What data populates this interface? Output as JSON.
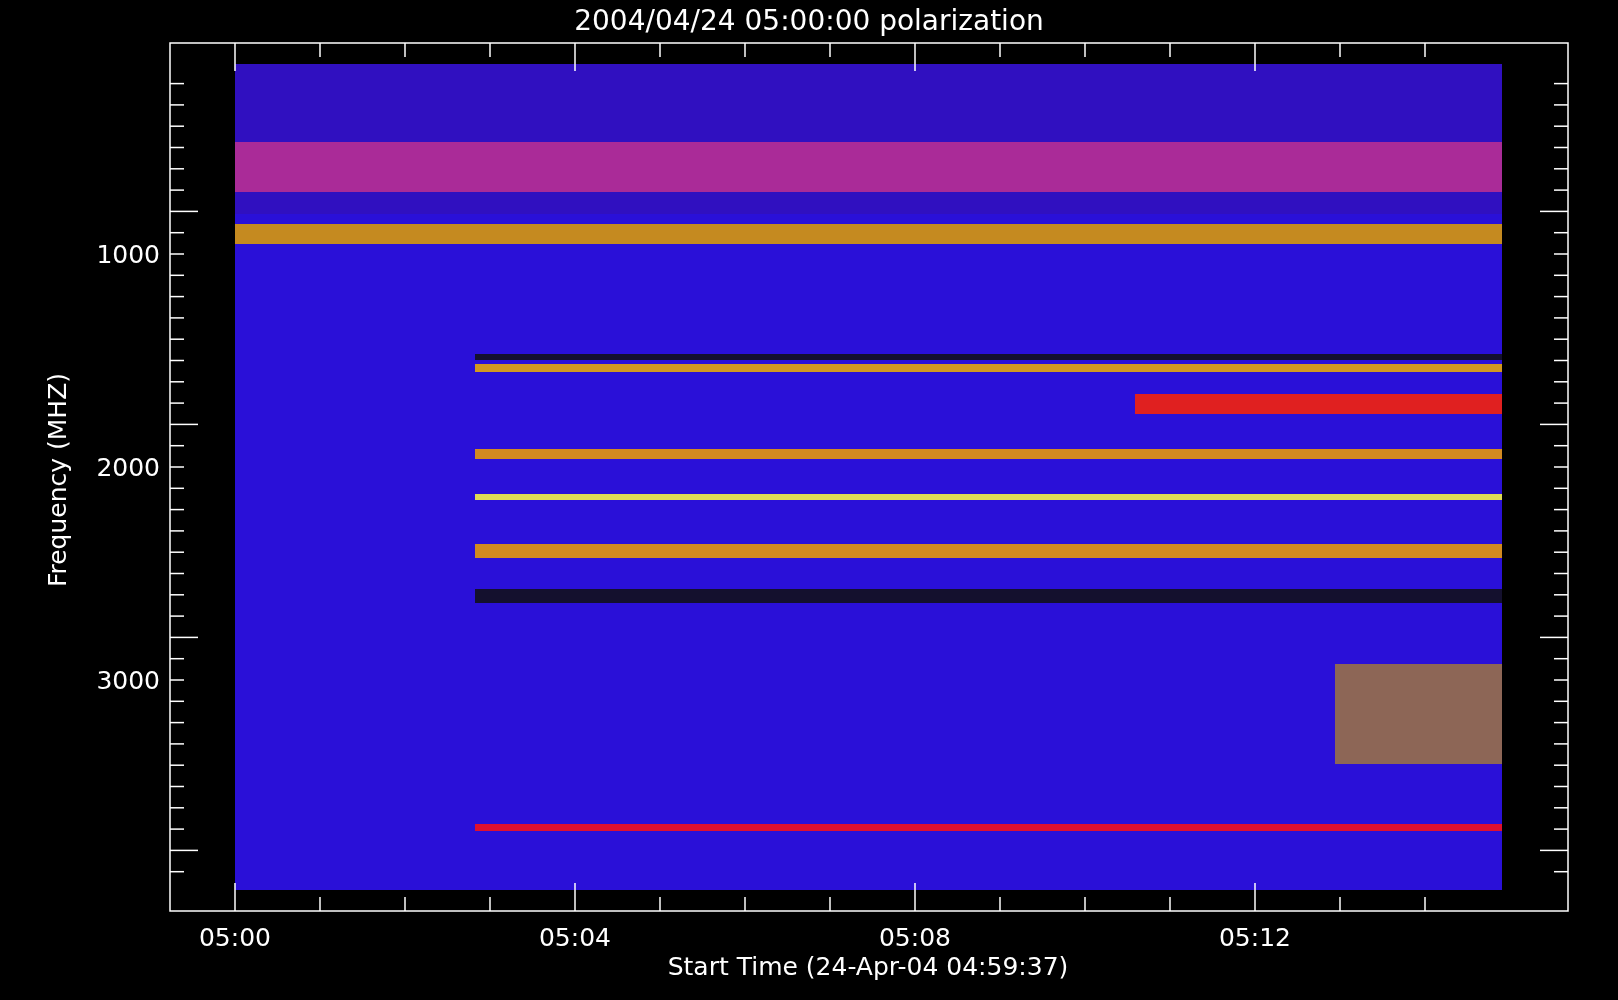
{
  "title": "2004/04/24 05:00:00 polarization",
  "y_axis": {
    "label": "Frequency (MHZ)",
    "tick_labels": [
      "1000",
      "2000",
      "3000"
    ]
  },
  "x_axis": {
    "label": "Start Time (24-Apr-04 04:59:37)",
    "tick_labels": [
      "05:00",
      "05:04",
      "05:08",
      "05:12"
    ]
  }
}
